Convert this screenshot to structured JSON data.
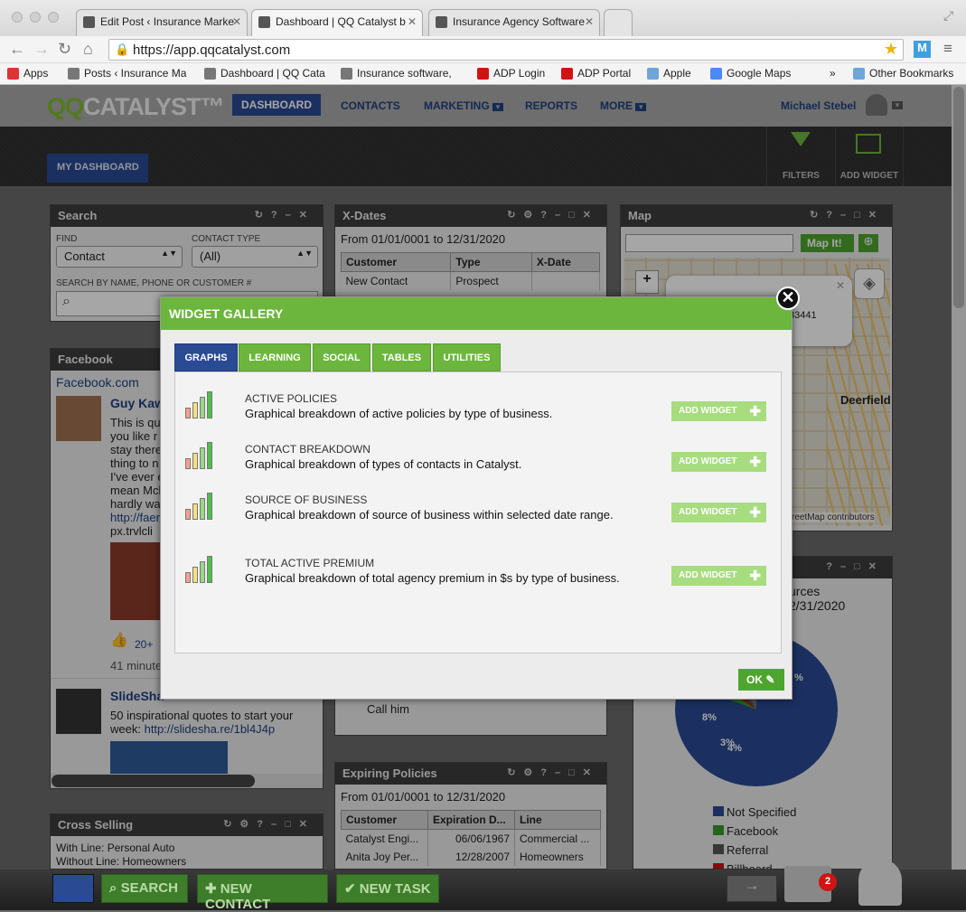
{
  "browser": {
    "tabs": [
      {
        "title": "Edit Post ‹ Insurance Marke"
      },
      {
        "title": "Dashboard | QQ Catalyst b"
      },
      {
        "title": "Insurance Agency Software"
      }
    ],
    "url": "https://app.qqcatalyst.com",
    "bookmarks": [
      "Apps",
      "Posts ‹ Insurance Ma",
      "Dashboard | QQ Cata",
      "Insurance software, ",
      "ADP Login",
      "ADP Portal",
      "Apple",
      "Google Maps",
      "»",
      "Other Bookmarks"
    ]
  },
  "app": {
    "logo_qq": "QQ",
    "logo_rest": "CATALYST™",
    "nav": [
      "DASHBOARD",
      "CONTACTS",
      "MARKETING",
      "REPORTS",
      "MORE"
    ],
    "user": "Michael Stebel",
    "my_dashboard": "MY DASHBOARD",
    "filters": "FILTERS",
    "add_widget": "ADD WIDGET"
  },
  "search_widget": {
    "title": "Search",
    "find_label": "FIND",
    "find_value": "Contact",
    "type_label": "CONTACT TYPE",
    "type_value": "(All)",
    "search_label": "SEARCH BY NAME, PHONE OR CUSTOMER #"
  },
  "facebook_widget": {
    "title": "Facebook",
    "link": "Facebook.com",
    "post_author": "Guy Kaw",
    "post_lines": [
      "This is qu",
      "you like r",
      "stay there",
      "thing to n",
      "I've ever e",
      "mean Mcl",
      "hardly wa"
    ],
    "post_link1": "http://faer",
    "post_link2": "px.trvlcli",
    "likes": "20+",
    "time": "41 minute",
    "slideshare": "SlideSha",
    "slideshare_text": "50 inspirational quotes to start your week:",
    "slideshare_link": "http://slidesha.re/1bl4J4p"
  },
  "cross_selling": {
    "title": "Cross Selling",
    "line1": "With Line: Personal Auto",
    "line2": "Without Line: Homeowners"
  },
  "xdates_widget": {
    "title": "X-Dates",
    "range": "From 01/01/0001 to 12/31/2020",
    "columns": [
      "Customer",
      "Type",
      "X-Date"
    ],
    "rows": [
      [
        "New Contact",
        "Prospect",
        ""
      ]
    ],
    "call_text": "Call him"
  },
  "expiring_widget": {
    "title": "Expiring Policies",
    "range": "From 01/01/0001 to 12/31/2020",
    "columns": [
      "Customer",
      "Expiration D...",
      "Line"
    ],
    "rows": [
      [
        "Catalyst Engi...",
        "06/06/1967",
        "Commercial ..."
      ],
      [
        "Anita Joy Per...",
        "12/28/2007",
        "Homeowners"
      ]
    ]
  },
  "map_widget": {
    "title": "Map",
    "button": "Map It!",
    "popup_zip": "33441",
    "place": "Deerfield",
    "credit": "reetMap contributors"
  },
  "sources_widget": {
    "title_part1": "urces",
    "title_part2": "2/31/2020",
    "legend": [
      "Not Specified",
      "Facebook",
      "Referral",
      "Billboard"
    ],
    "legend_colors": [
      "#2a4a94",
      "#3a9a2a",
      "#555555",
      "#cc1111"
    ],
    "pie_labels": [
      "8%",
      "3%",
      "4%",
      "%"
    ]
  },
  "modal": {
    "title": "WIDGET GALLERY",
    "tabs": [
      "GRAPHS",
      "LEARNING",
      "SOCIAL",
      "TABLES",
      "UTILITIES"
    ],
    "items": [
      {
        "name": "ACTIVE POLICIES",
        "desc": "Graphical breakdown of active policies by type of business."
      },
      {
        "name": "CONTACT BREAKDOWN",
        "desc": "Graphical breakdown of types of contacts in Catalyst."
      },
      {
        "name": "SOURCE OF BUSINESS",
        "desc": "Graphical breakdown of source of business within selected date range."
      },
      {
        "name": "TOTAL ACTIVE PREMIUM",
        "desc": "Graphical breakdown of total agency premium in $s by type of business."
      }
    ],
    "add_label": "ADD WIDGET",
    "ok": "OK"
  },
  "bottom": {
    "search": "SEARCH",
    "new_contact": "NEW CONTACT",
    "new_task": "NEW TASK",
    "badge": "2"
  }
}
